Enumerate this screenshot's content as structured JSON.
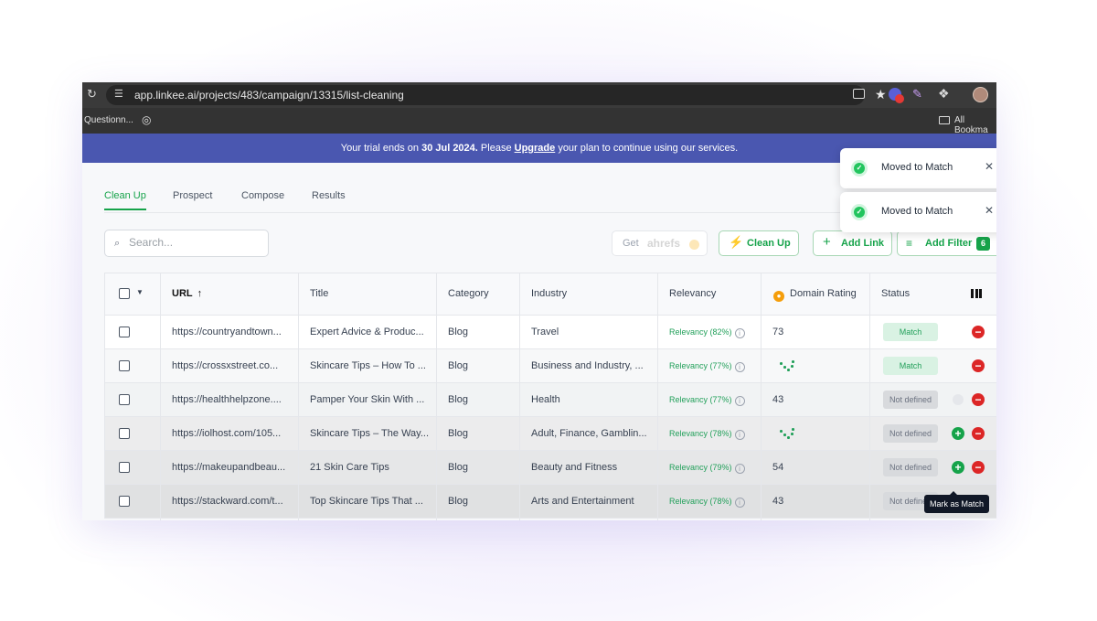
{
  "browser": {
    "url": "app.linkee.ai/projects/483/campaign/13315/list-cleaning",
    "bookmark_left": "Questionn...",
    "bookmark_right": "All Bookma"
  },
  "banner": {
    "prefix": "Your trial ends on",
    "date": "30 Jul 2024.",
    "middle": "Please",
    "link": "Upgrade",
    "suffix": "your plan to continue using our services."
  },
  "tabs": [
    "Clean Up",
    "Prospect",
    "Compose",
    "Results"
  ],
  "active_tab": "Clean Up",
  "search": {
    "placeholder": "Search..."
  },
  "toolbar": {
    "get_label": "Get",
    "get_logo": "ahrefs",
    "cleanup_label": "Clean Up",
    "addlink_label": "Add Link",
    "addfilter_label": "Add Filter",
    "filter_count": "6"
  },
  "table": {
    "columns": [
      "URL",
      "Title",
      "Category",
      "Industry",
      "Relevancy",
      "Domain Rating",
      "Status"
    ],
    "rows": [
      {
        "url": "https://countryandtown...",
        "title": "Expert Advice & Produc...",
        "category": "Blog",
        "industry": "Travel",
        "relevancy": "Relevancy (82%)",
        "dr": "73",
        "status": "Match"
      },
      {
        "url": "https://crossxstreet.co...",
        "title": "Skincare Tips – How To ...",
        "category": "Blog",
        "industry": "Business and Industry, ...",
        "relevancy": "Relevancy (77%)",
        "dr": "",
        "status": "Match"
      },
      {
        "url": "https://healthhelpzone....",
        "title": "Pamper Your Skin With ...",
        "category": "Blog",
        "industry": "Health",
        "relevancy": "Relevancy (77%)",
        "dr": "43",
        "status": "Not defined"
      },
      {
        "url": "https://iolhost.com/105...",
        "title": "Skincare Tips – The Way...",
        "category": "Blog",
        "industry": "Adult, Finance, Gamblin...",
        "relevancy": "Relevancy (78%)",
        "dr": "",
        "status": "Not defined"
      },
      {
        "url": "https://makeupandbeau...",
        "title": "21 Skin Care Tips",
        "category": "Blog",
        "industry": "Beauty and Fitness",
        "relevancy": "Relevancy (79%)",
        "dr": "54",
        "status": "Not defined"
      },
      {
        "url": "https://stackward.com/t...",
        "title": "Top Skincare Tips That ...",
        "category": "Blog",
        "industry": "Arts and Entertainment",
        "relevancy": "Relevancy (78%)",
        "dr": "43",
        "status": "Not defined"
      }
    ]
  },
  "tooltip": "Mark as Match",
  "toasts": [
    "Moved to Match",
    "Moved to Match"
  ],
  "colors": {
    "accent": "#16a34a",
    "banner": "#4a57b0",
    "danger": "#dc2626"
  }
}
